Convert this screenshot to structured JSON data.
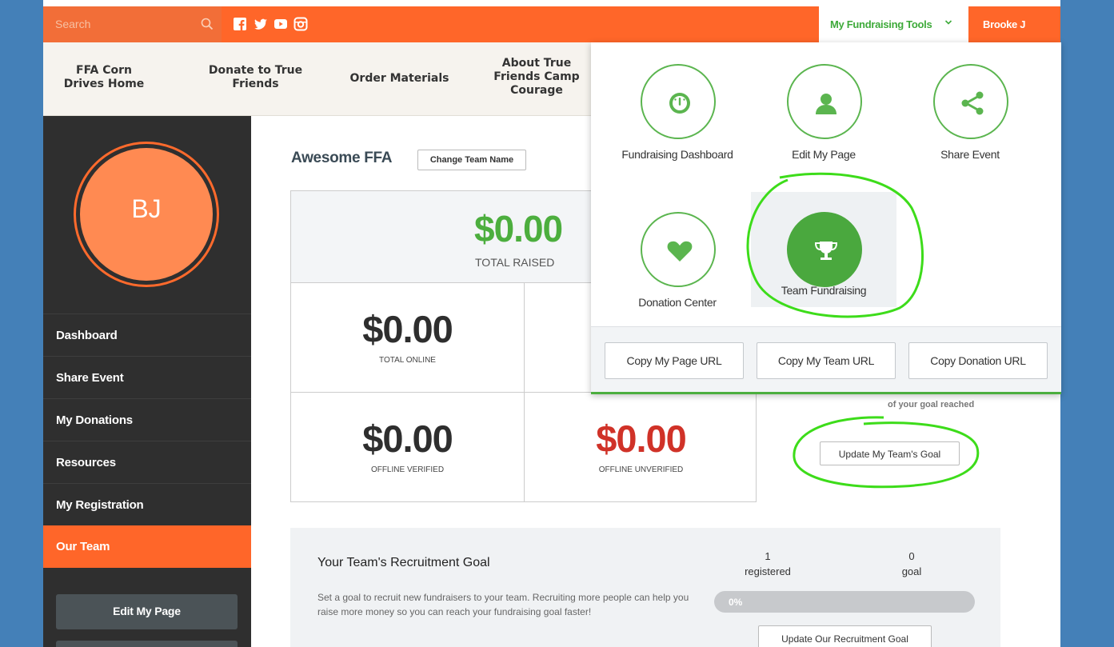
{
  "header": {
    "search_placeholder": "Search",
    "social": [
      "facebook-icon",
      "twitter-icon",
      "youtube-icon",
      "instagram-icon"
    ],
    "tools_label": "My Fundraising Tools",
    "user_name": "Brooke J"
  },
  "nav": {
    "items": [
      "FFA Corn Drives Home",
      "Donate to True Friends",
      "Order Materials",
      "About True Friends Camp Courage"
    ]
  },
  "sidebar": {
    "initials": "BJ",
    "items": [
      "Dashboard",
      "Share Event",
      "My Donations",
      "Resources",
      "My Registration",
      "Our Team"
    ],
    "active": "Our Team",
    "edit_page_button": "Edit My Page"
  },
  "team": {
    "name": "Awesome FFA",
    "change_name_button": "Change Team Name",
    "total_raised": "$0.00",
    "total_raised_label": "TOTAL RAISED",
    "total_online": "$0.00",
    "total_online_label": "TOTAL ONLINE",
    "offline_verified": "$0.00",
    "offline_verified_label": "OFFLINE VERIFIED",
    "offline_unverified": "$0.00",
    "offline_unverified_label": "OFFLINE UNVERIFIED",
    "goal_reached_text": "of your goal reached",
    "update_goal_button": "Update My Team's Goal"
  },
  "recruitment": {
    "title": "Your Team's Recruitment Goal",
    "description": "Set a goal to recruit new fundraisers to your team. Recruiting more people can help you raise more money so you can reach your fundraising goal faster!",
    "registered_count": "1",
    "registered_label": "registered",
    "goal_count": "0",
    "goal_label": "goal",
    "progress_text": "0%",
    "progress_value": 0,
    "update_button": "Update Our Recruitment Goal"
  },
  "dropdown": {
    "tools": [
      {
        "label": "Fundraising Dashboard",
        "icon": "dashboard-icon"
      },
      {
        "label": "Edit My Page",
        "icon": "person-icon"
      },
      {
        "label": "Share Event",
        "icon": "share-icon"
      },
      {
        "label": "Donation Center",
        "icon": "heart-icon"
      },
      {
        "label": "Team Fundraising",
        "icon": "trophy-icon"
      }
    ],
    "active_tool": "Team Fundraising",
    "copy_page_url": "Copy My Page URL",
    "copy_team_url": "Copy My Team URL",
    "copy_donation_url": "Copy Donation URL"
  },
  "colors": {
    "brand_orange": "#ff6629",
    "brand_green": "#4cae3e",
    "unverified_red": "#d03228",
    "page_blue": "#4480b8",
    "annotation_green": "#3ddc1a"
  }
}
